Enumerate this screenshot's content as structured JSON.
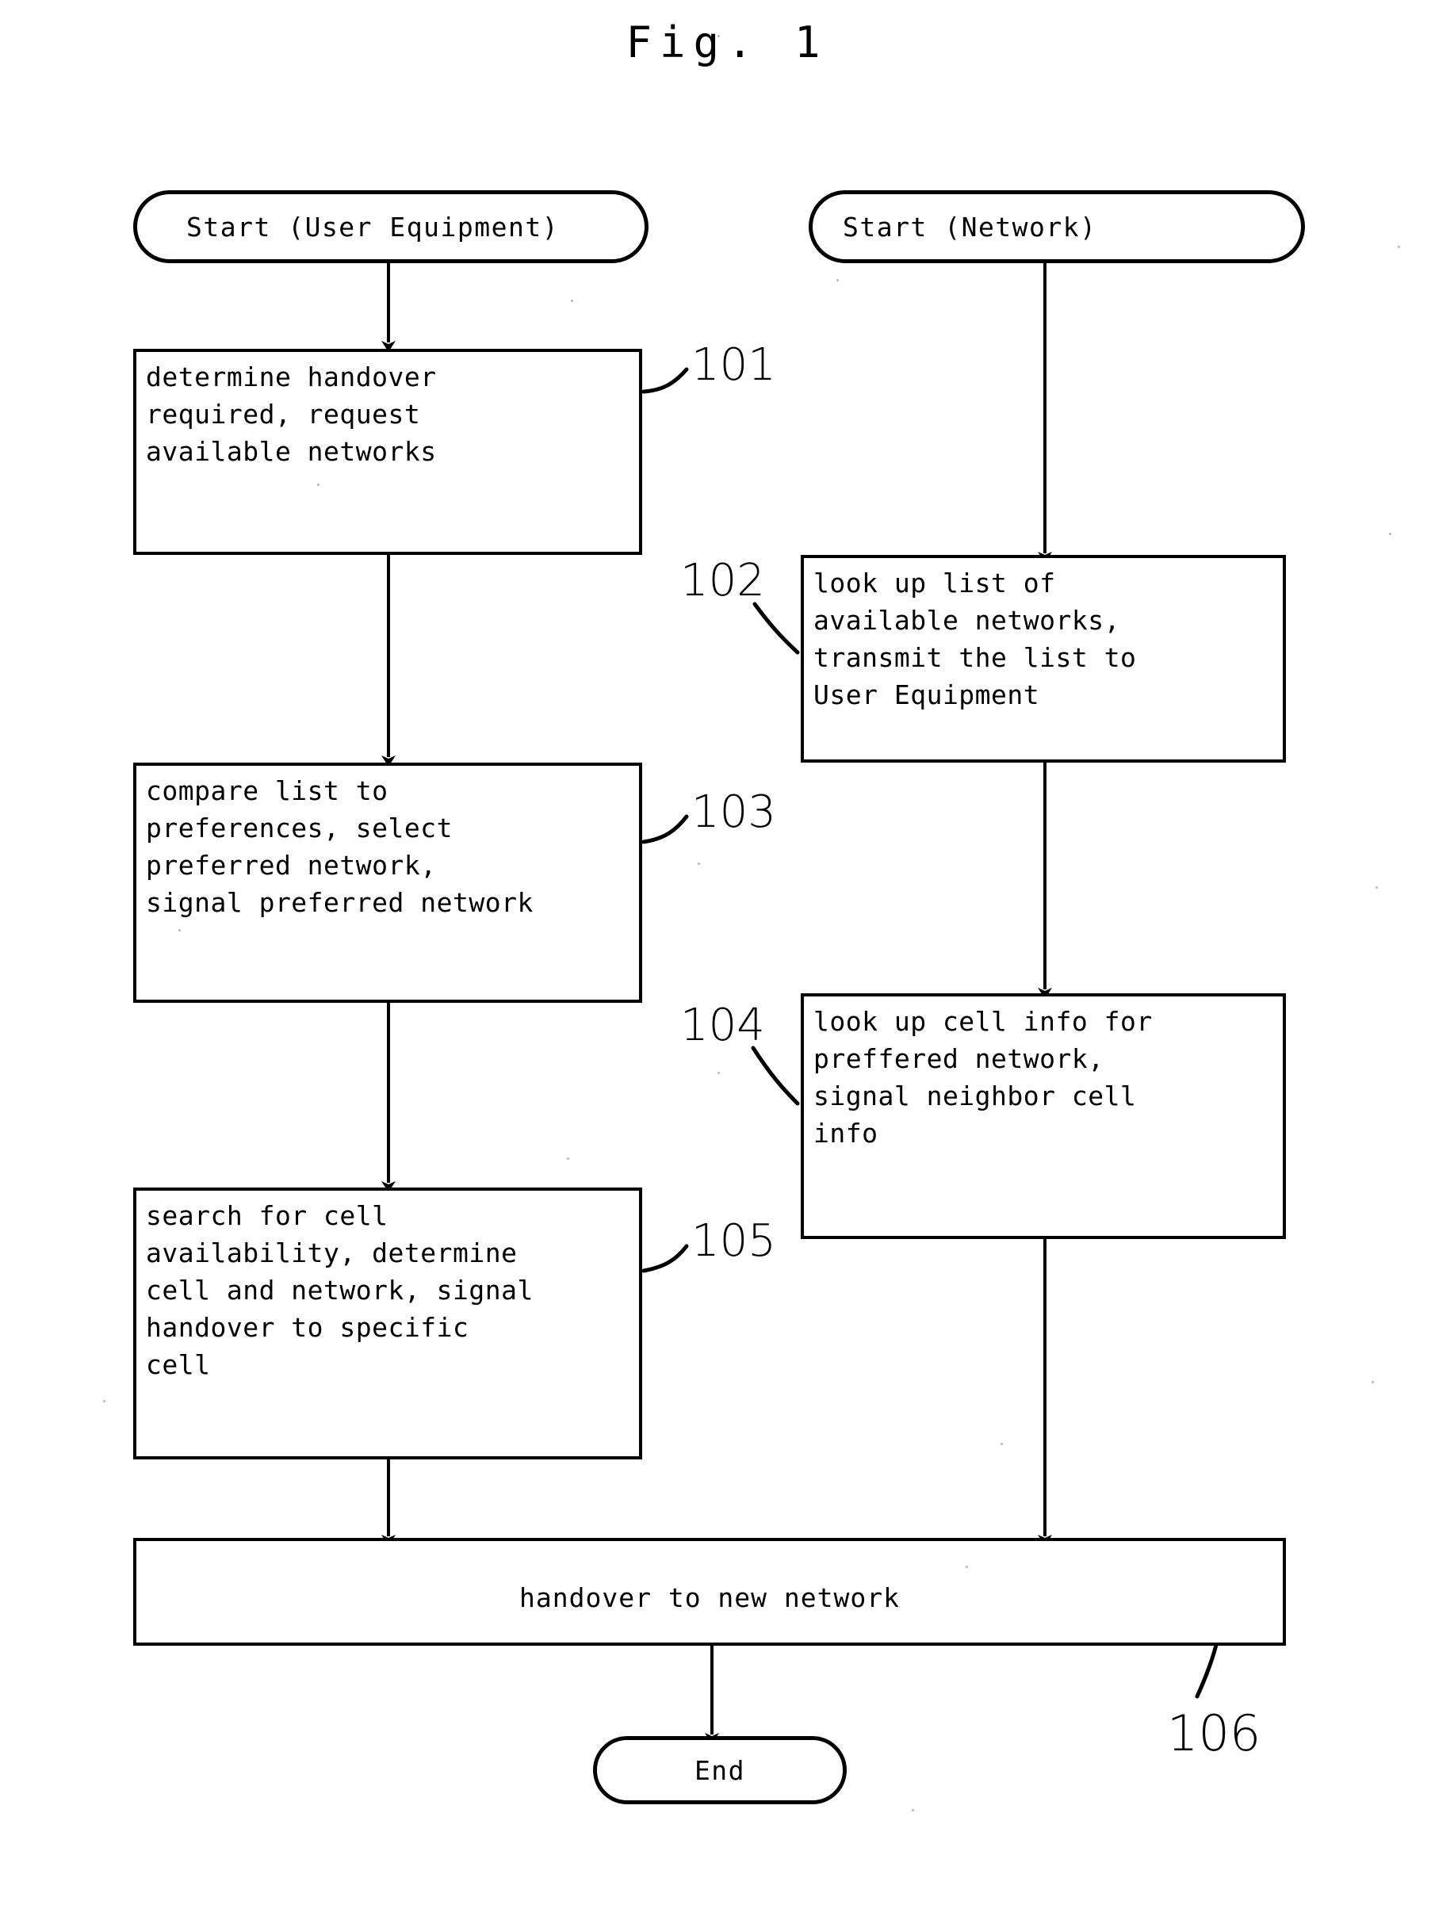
{
  "figure": {
    "title": "Fig. 1",
    "type": "patent-flowchart"
  },
  "nodes": {
    "start_ue": {
      "label": "Start (User Equipment)",
      "shape": "terminal"
    },
    "start_network": {
      "label": "Start (Network)",
      "shape": "terminal"
    },
    "step101": {
      "ref": "101",
      "text": "determine handover\nrequired, request\navailable networks",
      "shape": "process",
      "lane": "user-equipment"
    },
    "step102": {
      "ref": "102",
      "text": "look up list of\navailable networks,\ntransmit the list to\nUser Equipment",
      "shape": "process",
      "lane": "network"
    },
    "step103": {
      "ref": "103",
      "text": "compare list to\npreferences, select\npreferred network,\nsignal preferred network",
      "shape": "process",
      "lane": "user-equipment"
    },
    "step104": {
      "ref": "104",
      "text": "look up cell info for\npreffered network,\nsignal neighbor cell\ninfo",
      "shape": "process",
      "lane": "network"
    },
    "step105": {
      "ref": "105",
      "text": "search for cell\navailability, determine\ncell and network, signal\nhandover to specific\ncell",
      "shape": "process",
      "lane": "user-equipment"
    },
    "step106": {
      "ref": "106",
      "text": "handover to new network",
      "shape": "process",
      "lane": "both"
    },
    "end": {
      "label": "End",
      "shape": "terminal"
    }
  },
  "edges": [
    {
      "from": "start_ue",
      "to": "step101"
    },
    {
      "from": "step101",
      "to": "step103"
    },
    {
      "from": "step103",
      "to": "step105"
    },
    {
      "from": "step105",
      "to": "step106"
    },
    {
      "from": "start_network",
      "to": "step102"
    },
    {
      "from": "step102",
      "to": "step104"
    },
    {
      "from": "step104",
      "to": "step106"
    },
    {
      "from": "step106",
      "to": "end"
    }
  ],
  "colors": {
    "ink": "#000000",
    "paper": "#ffffff"
  }
}
